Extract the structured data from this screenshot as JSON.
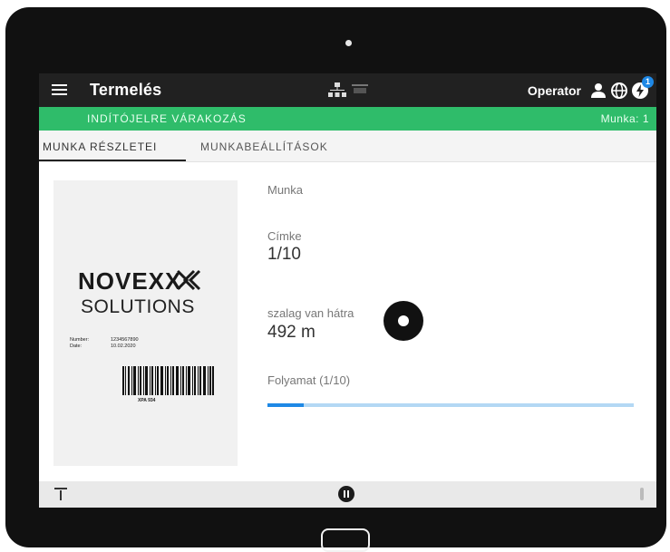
{
  "app": {
    "title": "Termelés",
    "operator_label": "Operator",
    "notification_count": "1"
  },
  "status": {
    "state": "INDÍTÓJELRE VÁRAKOZÁS",
    "job": "Munka: 1"
  },
  "tabs": [
    {
      "label": "MUNKA RÉSZLETEI",
      "active": true
    },
    {
      "label": "MUNKABEÁLLÍTÁSOK",
      "active": false
    }
  ],
  "label_preview": {
    "brand": "NOVEXX",
    "brand_sub": "SOLUTIONS",
    "number_label": "Number:",
    "number_value": "1234567890",
    "date_label": "Date:",
    "date_value": "10.02.2020",
    "barcode_text": "XPA 934"
  },
  "details": {
    "job_label": "Munka",
    "label_label": "Címke",
    "label_value": "1/10",
    "ribbon_label": "szalag van hátra",
    "ribbon_value": "492 m",
    "progress_label": "Folyamat (1/10)",
    "progress_fraction": 0.1
  },
  "icons": {
    "menu": "menu-icon",
    "network": "network-icon",
    "printer": "printer-icon",
    "user": "user-icon",
    "language": "globe-icon",
    "notifications": "notification-icon",
    "ribbon": "ribbon-roll-icon",
    "pause": "pause-icon"
  },
  "colors": {
    "appbar": "#212121",
    "status_green": "#2fbc6a",
    "accent_blue": "#1e88e5"
  }
}
